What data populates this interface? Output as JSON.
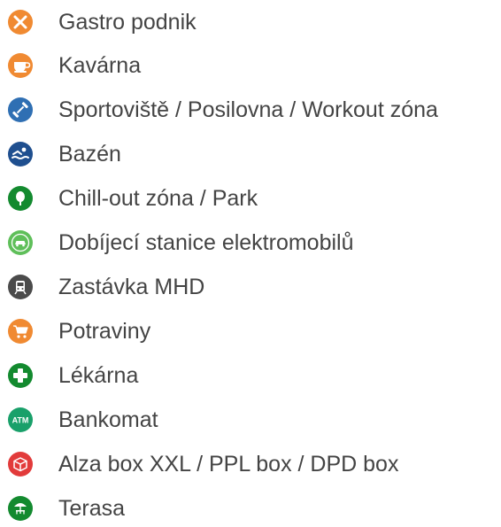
{
  "legend": {
    "items": [
      {
        "label": "Gastro podnik",
        "icon": "cutlery-icon",
        "color": "#f08a32"
      },
      {
        "label": "Kavárna",
        "icon": "coffee-cup-icon",
        "color": "#f08a32"
      },
      {
        "label": "Sportoviště / Posilovna / Workout zóna",
        "icon": "dumbbell-icon",
        "color": "#2f6fb3"
      },
      {
        "label": "Bazén",
        "icon": "swimmer-icon",
        "color": "#1f4f8f"
      },
      {
        "label": "Chill-out zóna / Park",
        "icon": "tree-icon",
        "color": "#138a2f"
      },
      {
        "label": "Dobíjecí stanice elektromobilů",
        "icon": "electric-car-icon",
        "color": "#5fbf5a"
      },
      {
        "label": "Zastávka MHD",
        "icon": "tram-icon",
        "color": "#4b4b4b"
      },
      {
        "label": "Potraviny",
        "icon": "shopping-cart-icon",
        "color": "#f08a32"
      },
      {
        "label": "Lékárna",
        "icon": "pharmacy-cross-icon",
        "color": "#138a2f"
      },
      {
        "label": "Bankomat",
        "icon": "atm-icon",
        "color": "#19a06a",
        "icon_text": "ATM"
      },
      {
        "label": "Alza box XXL / PPL box  / DPD box",
        "icon": "parcel-box-icon",
        "color": "#e23b3b"
      },
      {
        "label": "Terasa",
        "icon": "terrace-umbrella-icon",
        "color": "#138a2f"
      }
    ]
  }
}
